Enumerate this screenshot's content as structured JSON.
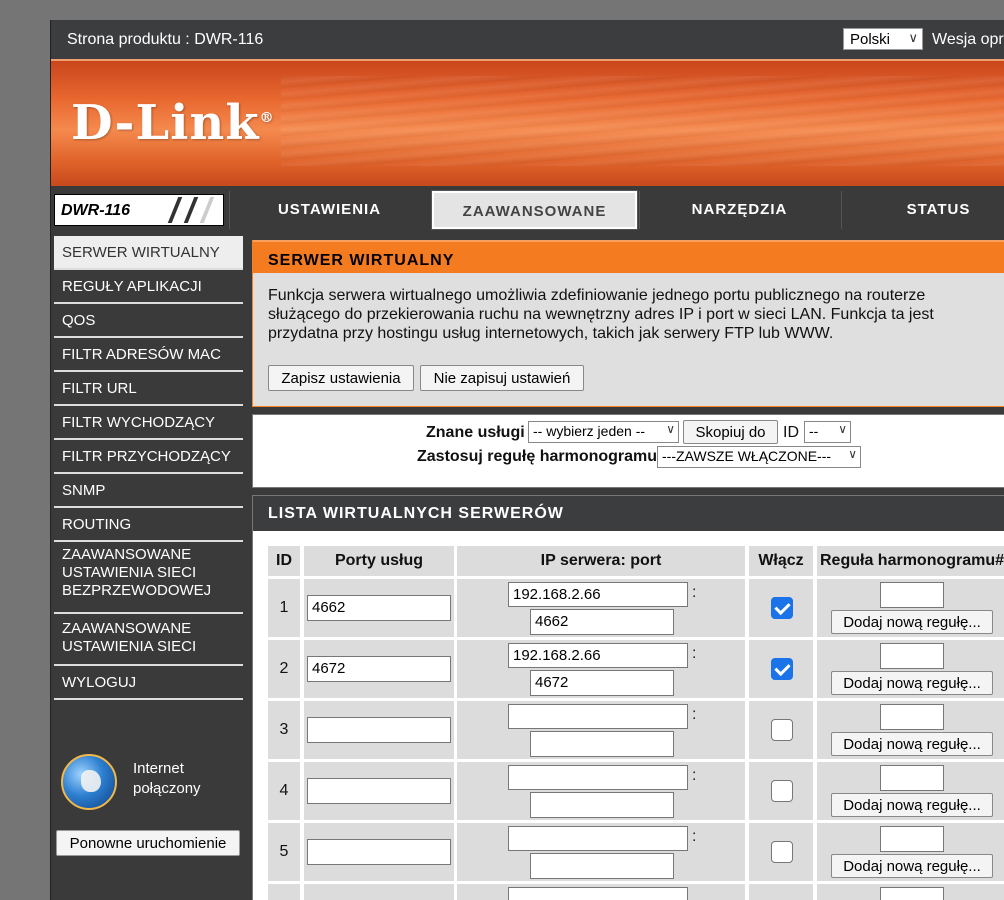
{
  "topbar": {
    "product_label": "Strona produktu : DWR-116",
    "language": "Polski",
    "firmware_label": "Wesja opr"
  },
  "banner": {
    "logo": "D-Link"
  },
  "model": "DWR-116",
  "tabs": [
    {
      "label": "USTAWIENIA"
    },
    {
      "label": "ZAAWANSOWANE"
    },
    {
      "label": "NARZĘDZIA"
    },
    {
      "label": "STATUS"
    }
  ],
  "sidebar": {
    "items": [
      {
        "label": "SERWER WIRTUALNY"
      },
      {
        "label": "REGUŁY APLIKACJI"
      },
      {
        "label": "QOS"
      },
      {
        "label": "FILTR ADRESÓW MAC"
      },
      {
        "label": "FILTR URL"
      },
      {
        "label": "FILTR WYCHODZĄCY"
      },
      {
        "label": "FILTR PRZYCHODZĄCY"
      },
      {
        "label": "SNMP"
      },
      {
        "label": "ROUTING"
      },
      {
        "label": "ZAAWANSOWANE USTAWIENIA SIECI BEZPRZEWODOWEJ"
      },
      {
        "label": "ZAAWANSOWANE USTAWIENIA SIECI"
      },
      {
        "label": "WYLOGUJ"
      }
    ],
    "internet_line1": "Internet",
    "internet_line2": "połączony",
    "reboot_label": "Ponowne uruchomienie"
  },
  "section1": {
    "title": "SERWER WIRTUALNY",
    "description": "Funkcja serwera wirtualnego umożliwia zdefiniowanie jednego portu publicznego na routerze służącego do przekierowania ruchu na wewnętrzny adres IP i port w sieci LAN. Funkcja ta jest przydatna przy hostingu usług internetowych, takich jak serwery FTP lub WWW.",
    "save_label": "Zapisz ustawienia",
    "nosave_label": "Nie zapisuj ustawień"
  },
  "section2": {
    "known_services_label": "Znane usługi",
    "known_services_value": "-- wybierz jeden --",
    "copy_label": "Skopiuj do",
    "id_label": "ID",
    "id_value": "--",
    "schedule_label": "Zastosuj regułę harmonogramu",
    "schedule_value": "---ZAWSZE WŁĄCZONE---"
  },
  "section3": {
    "title": "LISTA WIRTUALNYCH SERWERÓW",
    "columns": [
      "ID",
      "Porty usług",
      "IP serwera: port",
      "Włącz",
      "Reguła harmonogramu#"
    ],
    "add_rule_label": "Dodaj nową regułę...",
    "colon": ":",
    "rows": [
      {
        "id": "1",
        "ports": "4662",
        "ip": "192.168.2.66",
        "port": "4662",
        "enabled": true
      },
      {
        "id": "2",
        "ports": "4672",
        "ip": "192.168.2.66",
        "port": "4672",
        "enabled": true
      },
      {
        "id": "3",
        "ports": "",
        "ip": "",
        "port": "",
        "enabled": false
      },
      {
        "id": "4",
        "ports": "",
        "ip": "",
        "port": "",
        "enabled": false
      },
      {
        "id": "5",
        "ports": "",
        "ip": "",
        "port": "",
        "enabled": false
      }
    ]
  }
}
